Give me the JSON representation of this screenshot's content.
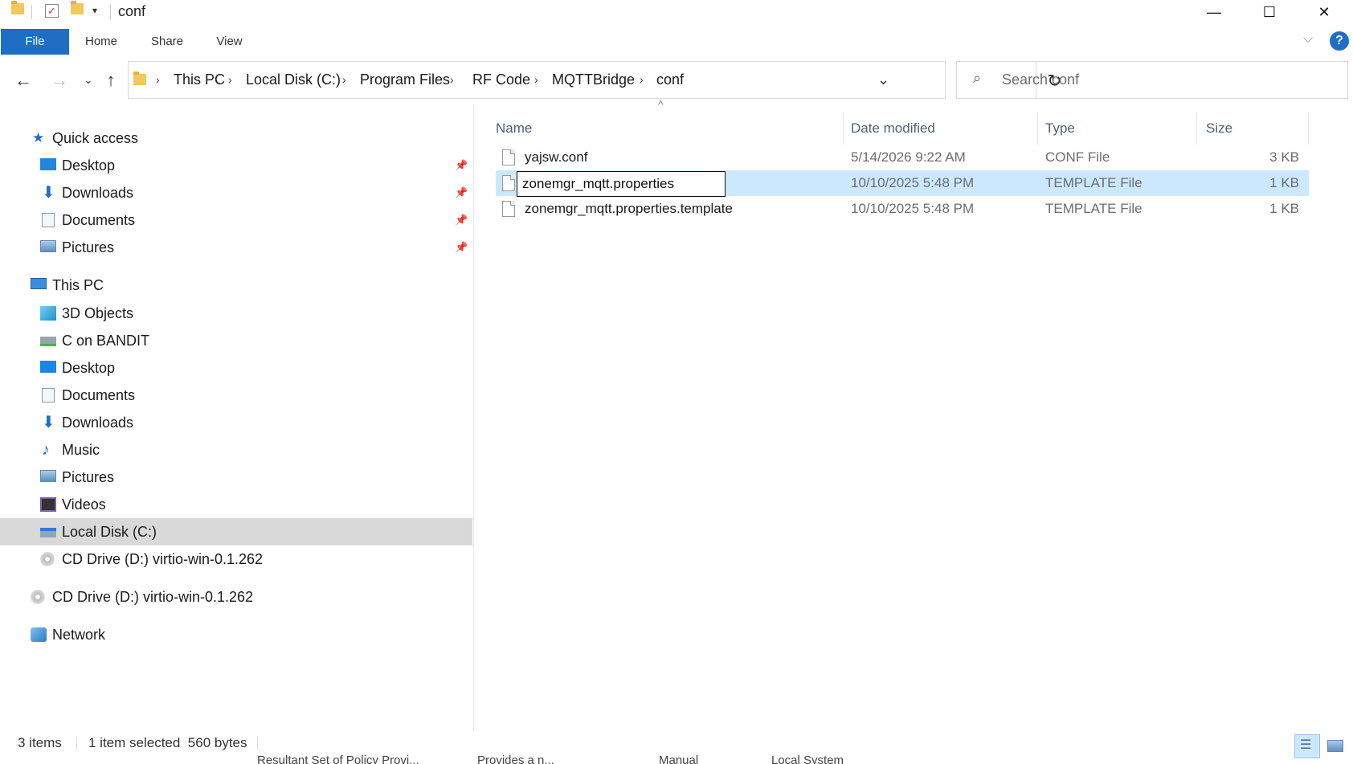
{
  "window": {
    "title": "conf",
    "minimize_glyph": "—",
    "maximize_glyph": "☐",
    "close_glyph": "✕"
  },
  "ribbon": {
    "tabs": [
      "File",
      "Home",
      "Share",
      "View"
    ],
    "help_glyph": "?"
  },
  "address": {
    "crumbs": [
      "This PC",
      "Local Disk (C:)",
      "Program Files",
      "RF Code",
      "MQTTBridge",
      "conf"
    ],
    "search_placeholder": "Search conf"
  },
  "navpane": {
    "quick_access": {
      "label": "Quick access",
      "items": [
        "Desktop",
        "Downloads",
        "Documents",
        "Pictures"
      ]
    },
    "this_pc": {
      "label": "This PC",
      "items": [
        "3D Objects",
        "C on BANDIT",
        "Desktop",
        "Documents",
        "Downloads",
        "Music",
        "Pictures",
        "Videos",
        "Local Disk (C:)",
        "CD Drive (D:) virtio-win-0.1.262"
      ]
    },
    "cd_drive": "CD Drive (D:) virtio-win-0.1.262",
    "network": "Network",
    "selected_item": "Local Disk (C:)"
  },
  "filelist": {
    "columns": [
      "Name",
      "Date modified",
      "Type",
      "Size"
    ],
    "sort_indicator": "^",
    "rows": [
      {
        "name": "yajsw.conf",
        "date": "5/14/2026 9:22 AM",
        "type": "CONF File",
        "size": "3 KB"
      },
      {
        "name": "zonemgr_mqtt.properties",
        "date": "10/10/2025 5:48 PM",
        "type": "TEMPLATE File",
        "size": "1 KB"
      },
      {
        "name": "zonemgr_mqtt.properties.template",
        "date": "10/10/2025 5:48 PM",
        "type": "TEMPLATE File",
        "size": "1 KB"
      }
    ],
    "rename_value": "zonemgr_mqtt.properties"
  },
  "status": {
    "item_count": "3 items",
    "selection": "1 item selected  560 bytes"
  },
  "background_bleed": [
    "Resultant Set of Policy Provi...",
    "Provides a n...",
    "Manual",
    "Local System"
  ],
  "colors": {
    "accent": "#1e6fc4",
    "selection": "#cce8ff",
    "nav_selected": "#d9d9d9"
  }
}
